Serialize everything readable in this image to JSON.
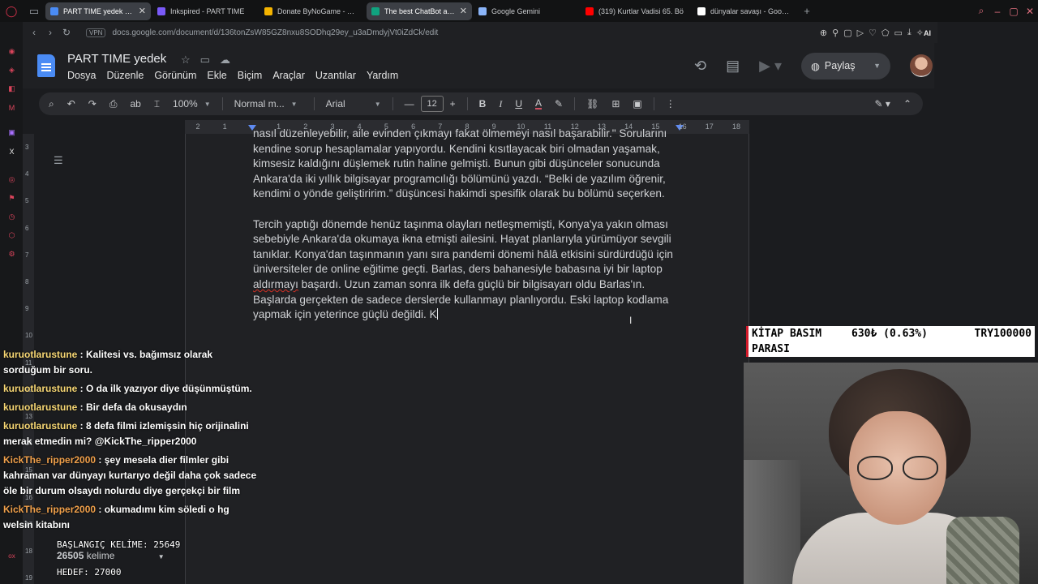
{
  "browser": {
    "tabs": [
      {
        "label": "PART TIME yedek - Google",
        "active": true,
        "color": "#4a8bf4"
      },
      {
        "label": "Inkspired - PART TIME",
        "active": false,
        "color": "#7a5af8"
      },
      {
        "label": "Donate ByNoGame - Geld",
        "active": false,
        "color": "#f5b400"
      },
      {
        "label": "The best ChatBot and",
        "active": true,
        "color": "#10a37f"
      },
      {
        "label": "Google Gemini",
        "active": false,
        "color": "#8ab4f8"
      },
      {
        "label": "(319) Kurtlar Vadisi 65. Bö",
        "active": false,
        "color": "#ff0000"
      },
      {
        "label": "dünyalar savaşı - Google'd",
        "active": false,
        "color": "#ffffff"
      }
    ],
    "vpn": "VPN",
    "url": "docs.google.com/document/d/136tonZsW85GZ8nxu8SODhq29ey_u3aDmdyjVt0iZdCk/edit",
    "ai_label": "AI"
  },
  "docs": {
    "title": "PART TIME yedek",
    "menu": [
      "Dosya",
      "Düzenle",
      "Görünüm",
      "Ekle",
      "Biçim",
      "Araçlar",
      "Uzantılar",
      "Yardım"
    ],
    "share_label": "Paylaş",
    "toolbar": {
      "zoom": "100%",
      "style": "Normal m...",
      "font": "Arial",
      "font_size": "12",
      "bold": "B",
      "italic": "I",
      "underline": "U",
      "text_color": "A"
    },
    "ruler_ticks": [
      "2",
      "1",
      "",
      "1",
      "2",
      "3",
      "4",
      "5",
      "6",
      "7",
      "8",
      "9",
      "10",
      "11",
      "12",
      "13",
      "14",
      "15",
      "16",
      "17",
      "18"
    ],
    "vruler_ticks": [
      "3",
      "4",
      "5",
      "6",
      "7",
      "8",
      "9",
      "10",
      "11",
      "12",
      "13",
      "14",
      "15",
      "16",
      "17",
      "18",
      "19"
    ],
    "paragraphs": [
      {
        "top_partial": "nasıl düzenleyebilir, aile evinden çıkmayı fakat ölmemeyi nasıl başarabilir.\" Sorularını",
        "text": "kendine sorup hesaplamalar yapıyordu. Kendini kısıtlayacak biri olmadan yaşamak, kimsesiz kaldığını düşlemek rutin haline gelmişti. Bunun gibi düşünceler sonucunda Ankara'da iki yıllık bilgisayar programcılığı bölümünü yazdı. “Belki de yazılım öğrenir, kendimi o yönde geliştiririm.” düşüncesi hakimdi spesifik olarak bu bölümü seçerken."
      },
      {
        "text_before_spell": "Tercih yaptığı dönemde henüz taşınma olayları netleşmemişti, Konya'ya yakın olması sebebiyle Ankara'da okumaya ikna etmişti ailesini. Hayat planlarıyla yürümüyor sevgili tanıklar. Konya'dan taşınmanın yanı sıra pandemi dönemi hâlâ etkisini sürdürdüğü için üniversiteler de online eğitime geçti. Barlas, ders bahanesiyle babasına iyi bir laptop ",
        "spell_word": "aldırmayı",
        "text_after_spell": " başardı. Uzun zaman sonra ilk defa güçlü bir bilgisayarı oldu Barlas'ın. Başlarda gerçekten de sadece derslerde kullanmayı planlıyordu. Eski laptop kodlama yapmak için yeterince güçlü değildi. K"
      }
    ]
  },
  "stream": {
    "chat": [
      {
        "user": "kuruotlarustune",
        "user_color": "#f7d774",
        "message": " : Kalitesi vs. bağımsız olarak sorduğum bir soru."
      },
      {
        "user": "kuruotlarustune",
        "user_color": "#f7d774",
        "message": " : O da ilk yazıyor diye düşünmüştüm."
      },
      {
        "user": "kuruotlarustune",
        "user_color": "#f7d774",
        "message": " : Bir defa da okusaydın"
      },
      {
        "user": "kuruotlarustune",
        "user_color": "#f7d774",
        "message": " : 8 defa filmi izlemişsin hiç orijinalini merak etmedin mi? @KickThe_ripper2000"
      },
      {
        "user": "KickThe_ripper2000",
        "user_color": "#f0a04b",
        "message": " : şey mesela dier filmler gibi kahraman var dünyayı kurtarıyo değil daha çok sadece öle bir durum olsaydı nolurdu diye gerçekçi bir film"
      },
      {
        "user": "KickThe_ripper2000",
        "user_color": "#f0a04b",
        "message": " : okumadımı kim söledi o hg welsin kitabını"
      }
    ],
    "start_words": "BAŞLANGIÇ KELİME: 25649",
    "word_count": "26505",
    "word_count_label": "kelime",
    "goal_words": "HEDEF: 27000",
    "ticker": {
      "label_line1": "KİTAP BASIM",
      "label_line2": "PARASI",
      "change": "630₺ (0.63%)",
      "target": "TRY100000"
    }
  }
}
